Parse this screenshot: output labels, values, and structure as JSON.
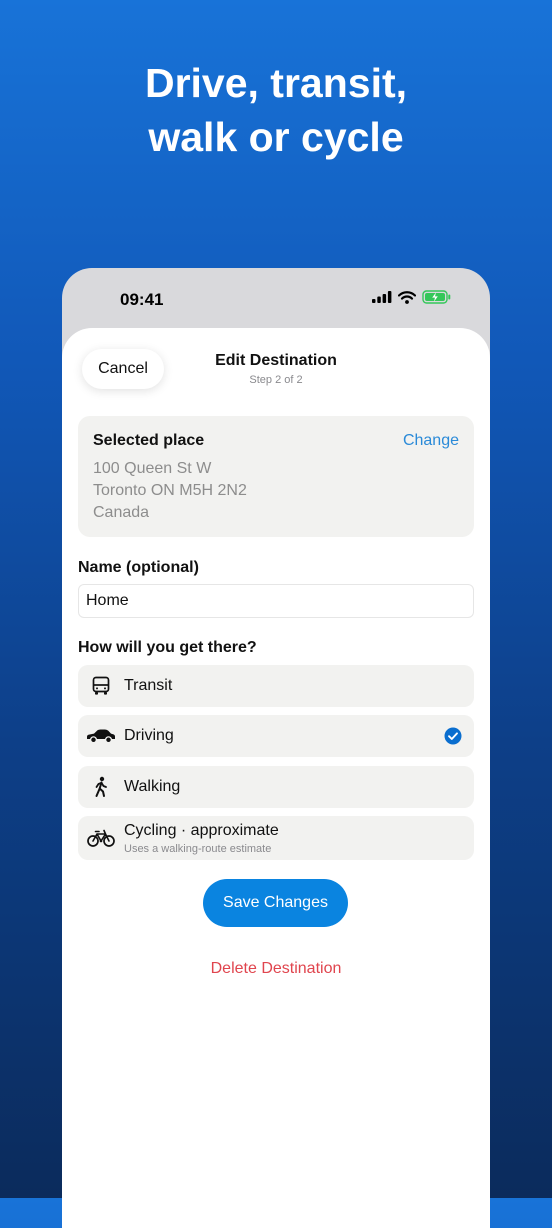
{
  "hero": {
    "line1": "Drive, transit,",
    "line2": "walk or cycle"
  },
  "status_bar": {
    "time": "09:41",
    "icons": [
      "signal-icon",
      "wifi-icon",
      "battery-charging-icon"
    ]
  },
  "nav": {
    "cancel_label": "Cancel",
    "title": "Edit Destination",
    "step": "Step 2 of 2"
  },
  "selected_place": {
    "label": "Selected place",
    "change_label": "Change",
    "address_lines": [
      "100 Queen St W",
      "Toronto ON M5H 2N2",
      "Canada"
    ]
  },
  "name_field": {
    "label": "Name (optional)",
    "value": "Home"
  },
  "travel": {
    "question": "How will you get there?",
    "modes": [
      {
        "label": "Transit",
        "icon": "bus-icon",
        "selected": false
      },
      {
        "label": "Driving",
        "icon": "car-icon",
        "selected": true
      },
      {
        "label": "Walking",
        "icon": "walking-icon",
        "selected": false
      },
      {
        "label": "Cycling · approximate",
        "sublabel": "Uses a walking-route estimate",
        "icon": "bicycle-icon",
        "selected": false
      }
    ]
  },
  "actions": {
    "save_label": "Save Changes",
    "delete_label": "Delete Destination"
  },
  "colors": {
    "accent": "#0a84e0",
    "link": "#2a8ad8",
    "destructive": "#e0454e",
    "battery": "#34c759"
  }
}
